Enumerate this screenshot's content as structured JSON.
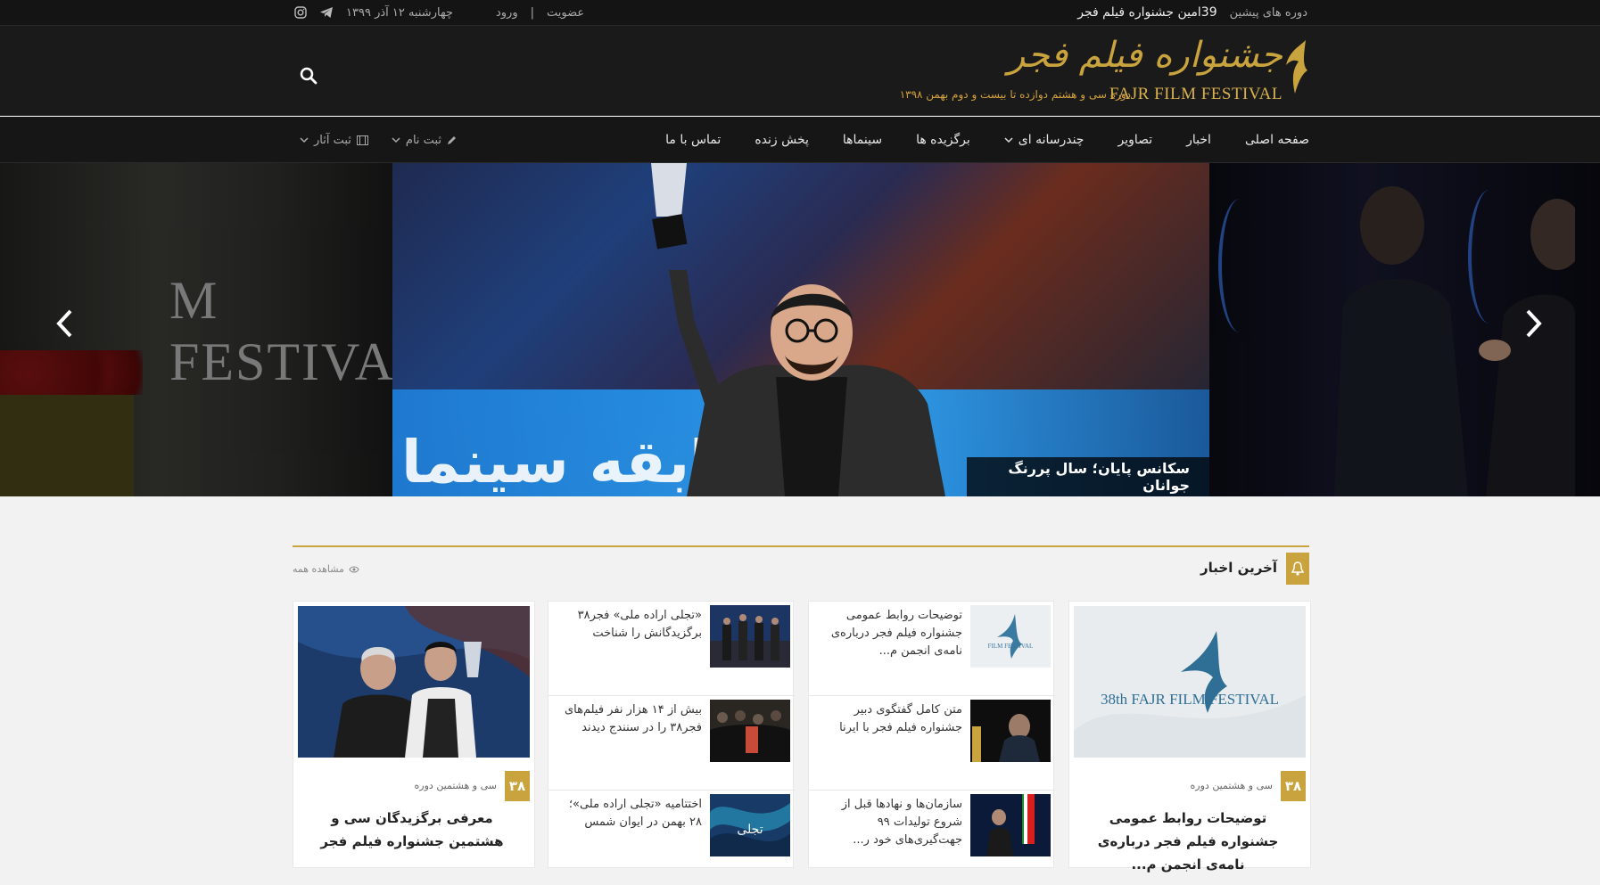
{
  "topbar": {
    "previous_periods": "دوره های پیشین",
    "festival": "39امین جشنواره فیلم فجر",
    "login": "ورود",
    "separator": "|",
    "register": "عضویت",
    "date": "چهارشنبه ۱۲ آذر ۱۳۹۹"
  },
  "logo": {
    "title_fa": "جشنواره فیلم فجر",
    "title_en": "FAJR FILM FESTIVAL",
    "subtitle": "دوره سی و هشتم دوازده تا بیست و دوم بهمن ۱۳۹۸"
  },
  "nav": {
    "items": [
      "صفحه اصلی",
      "اخبار",
      "تصاویر",
      "چندرسانه ای",
      "برگزیده ها",
      "سینماها",
      "پخش زنده",
      "تماس با ما"
    ],
    "register_name": "ثبت نام",
    "register_works": "ثبت آثار"
  },
  "slider": {
    "caption": "سکانس پایان؛ سال پررنگ جوانان",
    "left_text": "M FESTIVA",
    "banner_text": "مسابقه سینما"
  },
  "news": {
    "title": "آخرین اخبار",
    "see_all": "مشاهده همه",
    "featured_right": {
      "badge": "۳۸",
      "period": "سی و هشتمین دوره",
      "title": "توضیحات روابط عمومی جشنواره فیلم فجر درباره‌ی نامه‌ی انجمن م...",
      "image_text_en": "38th FAJR FILM FESTIVAL"
    },
    "list_mid_right": [
      "توضیحات روابط عمومی جشنواره فیلم فجر درباره‌ی نامه‌ی انجمن م...",
      "متن کامل گفتگوی دبیر جشنواره فیلم فجر با ایرنا",
      "سازمان‌ها و نهادها قبل از شروع تولیدات ۹۹ جهت‌گیری‌های خود ر..."
    ],
    "list_mid_left": [
      "«تجلی اراده ملی» فجر۳۸ برگزیدگانش را شناخت",
      "بیش از ۱۴ هزار نفر فیلم‌های فجر۳۸ را در سنندج دیدند",
      "اختتامیه «تجلی اراده ملی»؛ ۲۸ بهمن در ایوان شمس"
    ],
    "featured_left": {
      "badge": "۳۸",
      "period": "سی و هشتمین دوره",
      "title": "معرفی برگزیدگان سی و هشتمین جشنواره فیلم فجر"
    }
  },
  "colors": {
    "accent": "#c9a33d",
    "dark_bg": "#1a1a1a"
  }
}
